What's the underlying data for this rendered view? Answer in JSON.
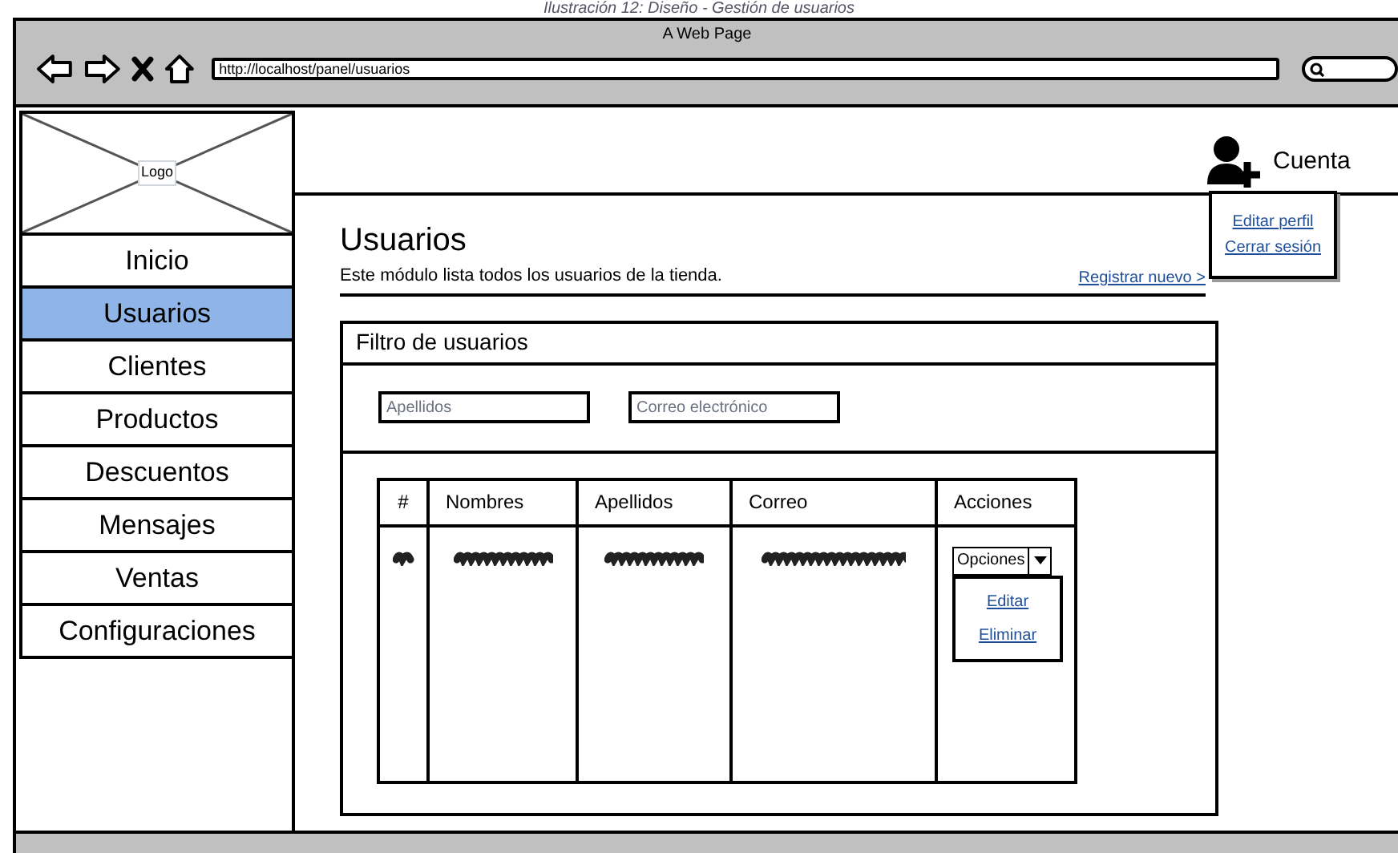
{
  "caption": "Ilustración 12: Diseño - Gestión de usuarios",
  "browser": {
    "title": "A Web Page",
    "url": "http://localhost/panel/usuarios"
  },
  "logo": "Logo",
  "account": {
    "label": "Cuenta",
    "expanded": true,
    "menu": [
      "Editar perfil",
      "Cerrar sesión"
    ]
  },
  "sidebar": {
    "items": [
      {
        "label": "Inicio",
        "selected": false
      },
      {
        "label": "Usuarios",
        "selected": true
      },
      {
        "label": "Clientes",
        "selected": false
      },
      {
        "label": "Productos",
        "selected": false
      },
      {
        "label": "Descuentos",
        "selected": false
      },
      {
        "label": "Mensajes",
        "selected": false
      },
      {
        "label": "Ventas",
        "selected": false
      },
      {
        "label": "Configuraciones",
        "selected": false
      }
    ]
  },
  "page": {
    "title": "Usuarios",
    "description": "Este módulo lista todos los usuarios de la tienda.",
    "register_link": "Registrar nuevo >"
  },
  "filter": {
    "title": "Filtro de usuarios",
    "fields": [
      {
        "placeholder": "Apellidos"
      },
      {
        "placeholder": "Correo electrónico"
      }
    ]
  },
  "table": {
    "columns": [
      "#",
      "Nombres",
      "Apellidos",
      "Correo",
      "Acciones"
    ],
    "actions": {
      "label": "Opciones",
      "expanded": true,
      "menu": [
        "Editar",
        "Eliminar"
      ]
    }
  }
}
